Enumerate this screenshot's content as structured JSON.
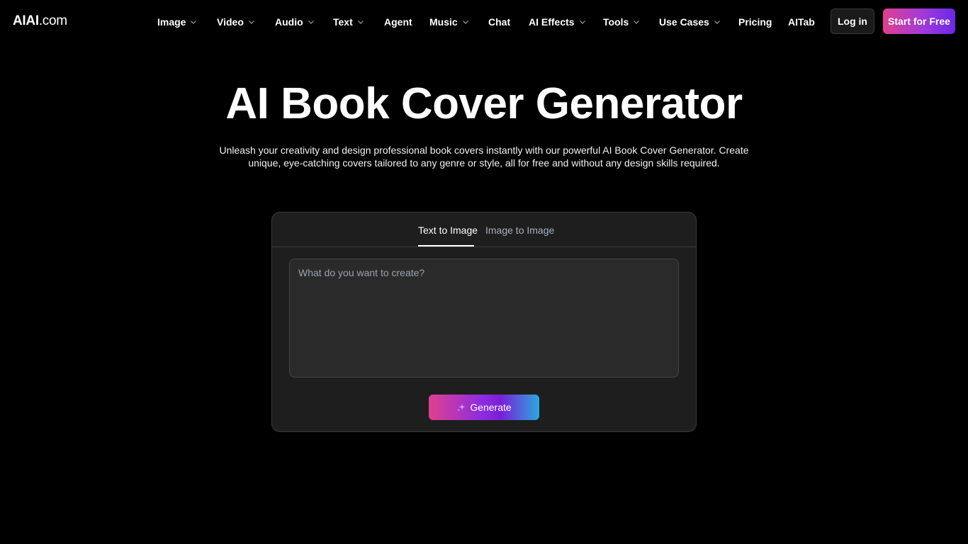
{
  "header": {
    "logo_strong": "AIAI",
    "logo_light": ".com",
    "nav": [
      {
        "label": "Image",
        "dropdown": true
      },
      {
        "label": "Video",
        "dropdown": true
      },
      {
        "label": "Audio",
        "dropdown": true
      },
      {
        "label": "Text",
        "dropdown": true
      },
      {
        "label": "Agent",
        "dropdown": false
      },
      {
        "label": "Music",
        "dropdown": true
      },
      {
        "label": "Chat",
        "dropdown": false
      },
      {
        "label": "AI Effects",
        "dropdown": true
      },
      {
        "label": "Tools",
        "dropdown": true
      },
      {
        "label": "Use Cases",
        "dropdown": true
      },
      {
        "label": "Pricing",
        "dropdown": false
      },
      {
        "label": "AITab",
        "dropdown": false
      }
    ],
    "login_label": "Log in",
    "start_label": "Start for Free"
  },
  "hero": {
    "title": "AI Book Cover Generator",
    "subtitle": "Unleash your creativity and design professional book covers instantly with our powerful AI Book Cover Generator. Create unique, eye-catching covers tailored to any genre or style, all for free and without any design skills required."
  },
  "generator": {
    "tabs": [
      {
        "label": "Text to Image",
        "active": true
      },
      {
        "label": "Image to Image",
        "active": false
      }
    ],
    "prompt_placeholder": "What do you want to create?",
    "prompt_value": "",
    "generate_label": "Generate",
    "generate_icon": "sparkle-icon"
  },
  "colors": {
    "background": "#000000",
    "card": "#1e1e1e",
    "input": "#2a2a2a",
    "accent_pink": "#e0408e",
    "accent_purple": "#8a2be2",
    "accent_cyan": "#2aa8e0"
  }
}
